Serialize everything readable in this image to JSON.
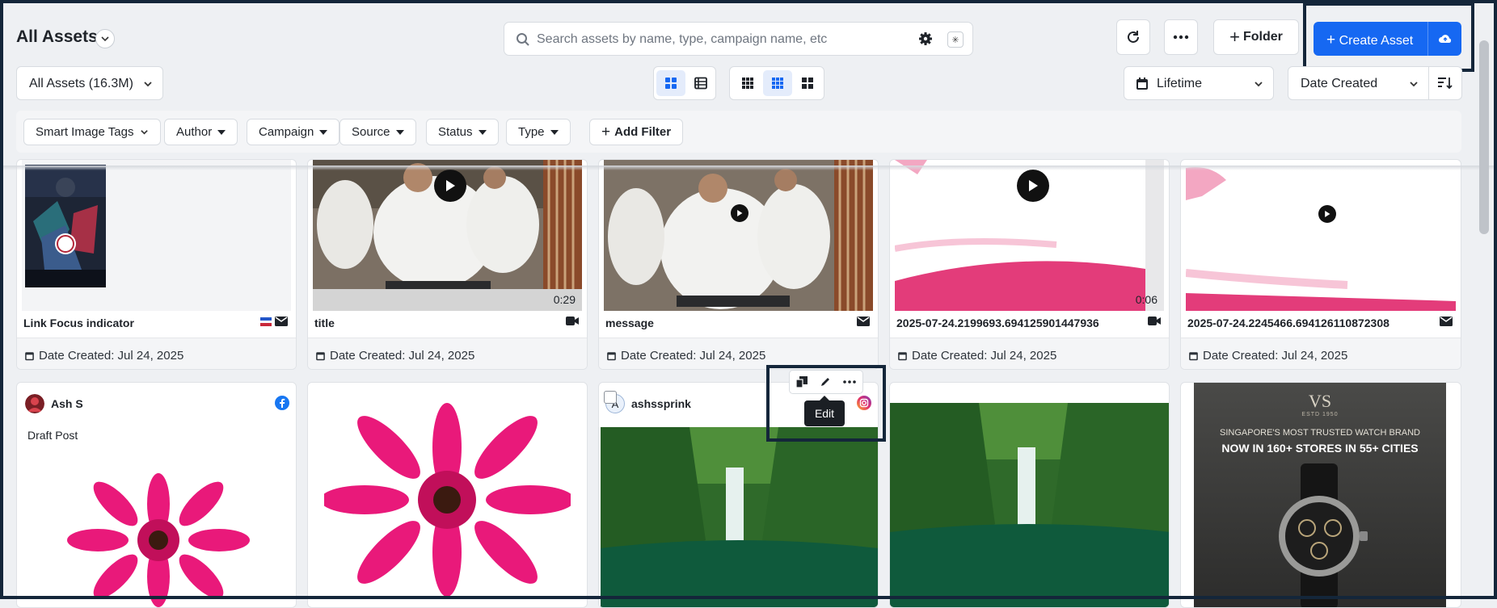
{
  "header": {
    "title": "All Assets",
    "search_placeholder": "Search assets by name, type, campaign name, etc",
    "ai_badge": "✳",
    "folder_label": "Folder",
    "create_label": "Create Asset"
  },
  "toolbar": {
    "scope_select": "All Assets (16.3M)",
    "time_select": "Lifetime",
    "sort_select": "Date Created"
  },
  "filters": [
    {
      "label": "Smart Image Tags",
      "style": "chevron"
    },
    {
      "label": "Author",
      "style": "triangle"
    },
    {
      "label": "Campaign",
      "style": "triangle"
    },
    {
      "label": "Source",
      "style": "triangle"
    },
    {
      "label": "Status",
      "style": "triangle"
    },
    {
      "label": "Type",
      "style": "triangle"
    }
  ],
  "add_filter_label": "Add Filter",
  "assets_row1": [
    {
      "name": "Link Focus indicator",
      "date": "Date Created: Jul 24, 2025",
      "kind": "image",
      "type_icons": [
        "flag-icon",
        "mail-icon"
      ]
    },
    {
      "name": "title",
      "date": "Date Created: Jul 24, 2025",
      "kind": "video",
      "duration": "0:29",
      "type_icons": [
        "video-icon"
      ]
    },
    {
      "name": "message",
      "date": "Date Created: Jul 24, 2025",
      "kind": "video",
      "type_icons": [
        "mail-icon"
      ]
    },
    {
      "name": "2025-07-24.2199693.694125901447936",
      "date": "Date Created: Jul 24, 2025",
      "kind": "video",
      "duration": "0:06",
      "type_icons": [
        "video-icon"
      ]
    },
    {
      "name": "2025-07-24.2245466.694126110872308",
      "date": "Date Created: Jul 24, 2025",
      "kind": "video",
      "type_icons": [
        "mail-icon"
      ]
    }
  ],
  "assets_row2": [
    {
      "author": "Ash S",
      "caption": "Draft Post",
      "network": "facebook-icon"
    },
    {
      "author": "",
      "caption": ""
    },
    {
      "author": "ashssprink",
      "avatar_letter": "A",
      "network": "instagram-icon"
    },
    {
      "author": "",
      "caption": ""
    },
    {
      "ad_brand": "VS",
      "ad_est": "ESTD 1950",
      "ad_line1": "SINGAPORE'S MOST TRUSTED WATCH BRAND",
      "ad_line2": "NOW IN 160+ STORES IN 55+ CITIES"
    }
  ],
  "tooltip": "Edit",
  "colors": {
    "primary": "#1668f2",
    "highlight": "#14263a",
    "pink": "#e33c7a",
    "flower": "#e9197a"
  }
}
